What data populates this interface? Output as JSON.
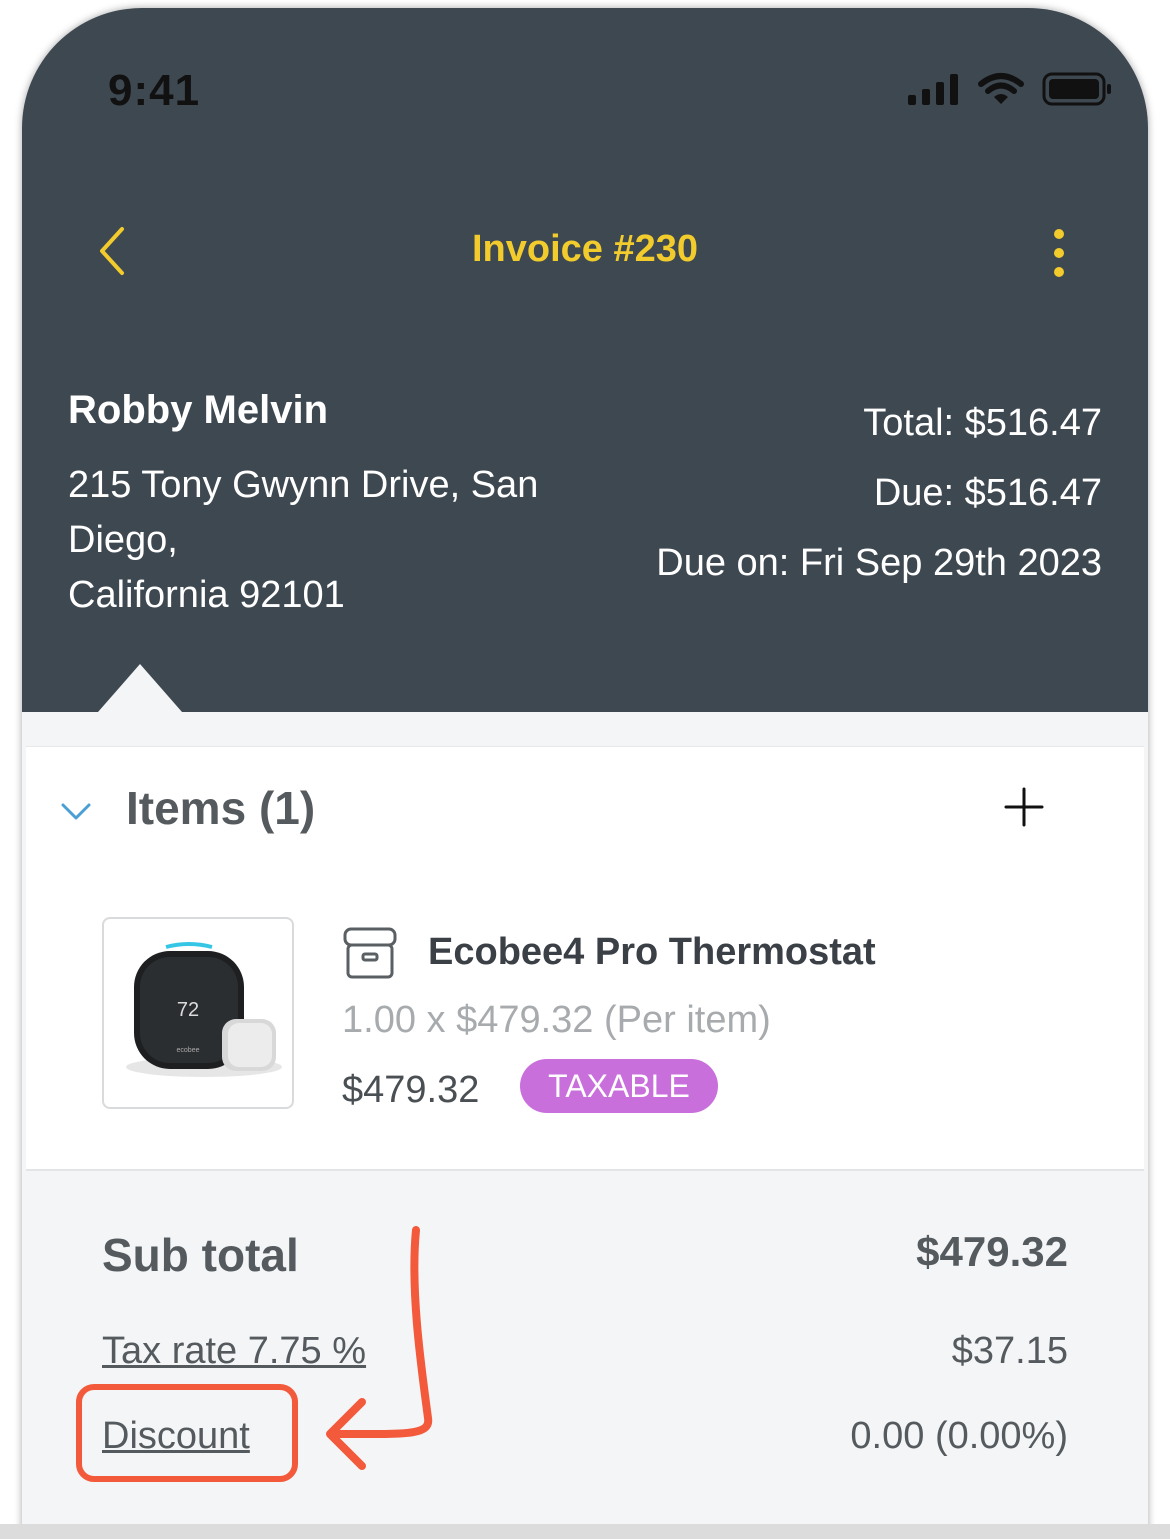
{
  "status_bar": {
    "time": "9:41",
    "icons": [
      "signal-icon",
      "wifi-icon",
      "battery-icon"
    ]
  },
  "nav": {
    "back_icon": "chevron-left-icon",
    "title": "Invoice #230",
    "more_icon": "more-vertical-icon"
  },
  "client": {
    "name": "Robby Melvin",
    "address_line1": "215 Tony Gwynn Drive, San Diego,",
    "address_line2": "California 92101"
  },
  "summary": {
    "total": "Total: $516.47",
    "due": "Due: $516.47",
    "due_on": "Due on: Fri Sep 29th 2023"
  },
  "items_section": {
    "title": "Items (1)",
    "expand_icon": "chevron-down-icon",
    "add_icon": "plus-icon",
    "items": [
      {
        "name": "Ecobee4 Pro Thermostat",
        "quantity_line": "1.00 x $479.32 (Per item)",
        "price": "$479.32",
        "badge": "TAXABLE",
        "type_icon": "archive-box-icon",
        "thumb_display": "72",
        "thumb_brand": "ecobee"
      }
    ]
  },
  "totals": {
    "subtotal_label": "Sub total",
    "subtotal_value": "$479.32",
    "tax_label": "Tax rate 7.75 %",
    "tax_value": "$37.15",
    "discount_label": "Discount",
    "discount_value": "0.00 (0.00%)"
  },
  "colors": {
    "header_bg": "#3e4850",
    "accent_yellow": "#f2cb2d",
    "badge_purple": "#c96fdc",
    "annotation_red": "#f3593b",
    "chevron_blue": "#4a9fd5"
  }
}
